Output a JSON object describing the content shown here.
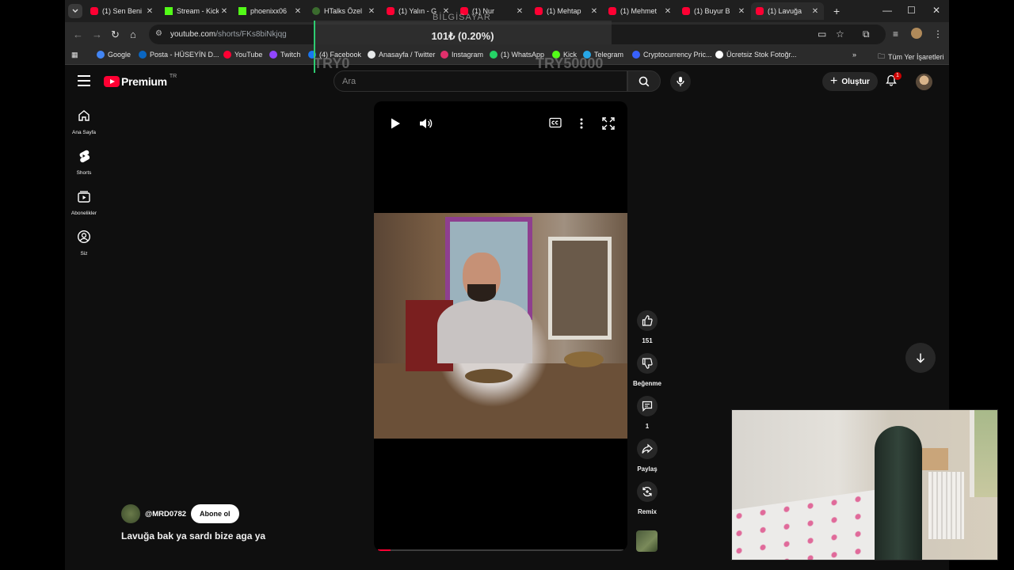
{
  "browser": {
    "tabs": [
      {
        "title": "(1) Sen Beni",
        "favicon": "youtube-icon",
        "active": false
      },
      {
        "title": "Stream - Kick",
        "favicon": "kick-icon",
        "active": false
      },
      {
        "title": "phoenixx06",
        "favicon": "kick-icon",
        "active": false
      },
      {
        "title": "HTalks Özel",
        "favicon": "htalks-icon",
        "active": false
      },
      {
        "title": "(1) Yalın - G",
        "favicon": "youtube-icon",
        "active": false
      },
      {
        "title": "(1) Nur",
        "favicon": "youtube-icon",
        "active": false
      },
      {
        "title": "(1) Mehtap",
        "favicon": "youtube-icon",
        "active": false
      },
      {
        "title": "(1) Mehmet",
        "favicon": "youtube-icon",
        "active": false
      },
      {
        "title": "(1) Buyur B",
        "favicon": "youtube-icon",
        "active": false
      },
      {
        "title": "(1) Lavuğa",
        "favicon": "youtube-icon",
        "active": true
      }
    ],
    "url": {
      "host": "youtube.com",
      "path": "/shorts/FKs8biNkjqg"
    },
    "bookmarks": [
      {
        "label": "Google",
        "color": "#4285f4"
      },
      {
        "label": "Posta - HÜSEYİN D...",
        "color": "#0a66c2"
      },
      {
        "label": "YouTube",
        "color": "#ff0033"
      },
      {
        "label": "Twitch",
        "color": "#9146ff"
      },
      {
        "label": "(4) Facebook",
        "color": "#1877f2"
      },
      {
        "label": "Anasayfa / Twitter",
        "color": "#e7e9ea"
      },
      {
        "label": "Instagram",
        "color": "#e1306c"
      },
      {
        "label": "(1) WhatsApp",
        "color": "#25d366"
      },
      {
        "label": "Kick",
        "color": "#53fc18"
      },
      {
        "label": "Telegram",
        "color": "#27a7e7"
      },
      {
        "label": "Cryptocurrency Pric...",
        "color": "#3861fb"
      },
      {
        "label": "Ücretsiz Stok Fotoğr...",
        "color": "#ffffff"
      }
    ],
    "all_bookmarks": "Tüm Yer İşaretleri"
  },
  "overlay": {
    "label": "BİLGİSAYAR",
    "price": "101₺ (0.20%)",
    "min": "TRY0",
    "max": "TRY50000"
  },
  "youtube": {
    "logo": "Premium",
    "region": "TR",
    "search_placeholder": "Ara",
    "create_label": "Oluştur",
    "notifications": "1",
    "nav": [
      {
        "label": "Ana Sayfa",
        "icon": "home-icon"
      },
      {
        "label": "Shorts",
        "icon": "shorts-icon"
      },
      {
        "label": "Abonelikler",
        "icon": "subscriptions-icon"
      },
      {
        "label": "Siz",
        "icon": "you-icon"
      }
    ],
    "short": {
      "likes": "151",
      "dislike_label": "Beğenme",
      "comments": "1",
      "share_label": "Paylaş",
      "remix_label": "Remix",
      "channel": "@MRD0782",
      "subscribe_label": "Abone ol",
      "title": "Lavuğa bak ya sardı bize aga ya",
      "progress_pct": 5
    }
  }
}
